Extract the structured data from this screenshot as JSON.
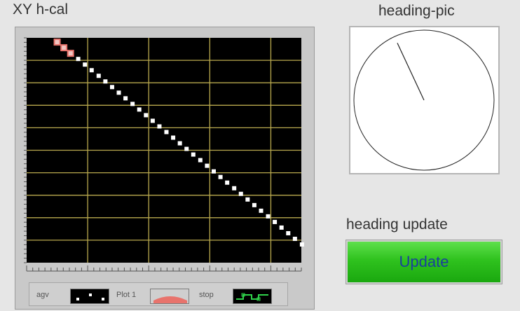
{
  "xy_graph": {
    "title": "XY h-cal",
    "legend": [
      {
        "name": "agv",
        "color": "#ffffff"
      },
      {
        "name": "Plot 1",
        "color": "#e8736c"
      },
      {
        "name": "stop",
        "color": "#2fd24a"
      }
    ]
  },
  "heading": {
    "title": "heading-pic",
    "needle_angle_deg": 335
  },
  "update": {
    "label": "heading update",
    "button": "Update",
    "color": "#2fc21e"
  },
  "chart_data": {
    "type": "scatter",
    "title": "XY h-cal",
    "xlabel": "",
    "ylabel": "",
    "grid": true,
    "legend_position": "bottom",
    "series": [
      {
        "name": "agv",
        "color": "#ffffff",
        "x": [
          0.69,
          0.91,
          1.13,
          1.36,
          1.58,
          1.8,
          2.02,
          2.24,
          2.47,
          2.69,
          2.91,
          3.13,
          3.35,
          3.58,
          3.8,
          4.02,
          4.24,
          4.46,
          4.69,
          4.91,
          5.13,
          5.35,
          5.57,
          5.8,
          6.02,
          6.24,
          6.46,
          6.68,
          6.91,
          7.13,
          7.35,
          7.57,
          7.79,
          8.02
        ],
        "y": [
          6.06,
          5.81,
          5.56,
          5.31,
          5.06,
          4.81,
          4.56,
          4.31,
          4.06,
          3.81,
          3.56,
          3.31,
          3.06,
          2.81,
          2.56,
          2.31,
          2.06,
          1.81,
          1.56,
          1.31,
          1.06,
          0.81,
          0.56,
          0.31,
          0.06,
          -0.19,
          -0.44,
          -0.69,
          -0.94,
          -1.19,
          -1.44,
          -1.69,
          -1.94,
          -2.19
        ]
      },
      {
        "name": "Plot 1",
        "color": "#e8736c",
        "x": [
          0.0,
          0.22,
          0.44
        ],
        "y": [
          6.81,
          6.56,
          6.31
        ]
      }
    ]
  }
}
